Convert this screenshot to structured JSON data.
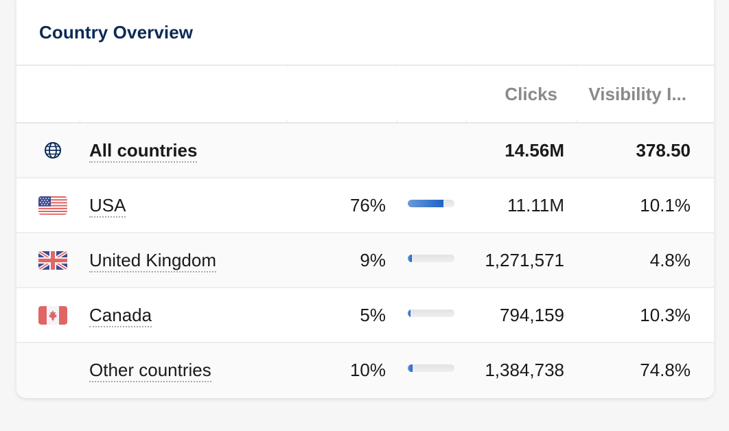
{
  "card": {
    "title": "Country Overview"
  },
  "table": {
    "columns": [
      {
        "key": "flag",
        "label": ""
      },
      {
        "key": "country",
        "label": ""
      },
      {
        "key": "share",
        "label": ""
      },
      {
        "key": "share_bar",
        "label": ""
      },
      {
        "key": "clicks",
        "label": "Clicks"
      },
      {
        "key": "visibility",
        "label": "Visibility I..."
      }
    ],
    "total": {
      "icon": "globe-icon",
      "country": "All countries",
      "clicks": "14.56M",
      "visibility": "378.50"
    },
    "rows": [
      {
        "icon": "flag-usa-icon",
        "country": "USA",
        "share": "76%",
        "share_fraction": 0.76,
        "clicks": "11.11M",
        "visibility": "10.1%"
      },
      {
        "icon": "flag-uk-icon",
        "country": "United Kingdom",
        "share": "9%",
        "share_fraction": 0.09,
        "clicks": "1,271,571",
        "visibility": "4.8%"
      },
      {
        "icon": "flag-canada-icon",
        "country": "Canada",
        "share": "5%",
        "share_fraction": 0.05,
        "clicks": "794,159",
        "visibility": "10.3%"
      },
      {
        "icon": "",
        "country": "Other countries",
        "share": "10%",
        "share_fraction": 0.1,
        "clicks": "1,384,738",
        "visibility": "74.8%"
      }
    ]
  },
  "colors": {
    "title": "#0b2a55",
    "header_text": "#8a8a8a",
    "bar_fill": "#1f62c9",
    "bar_track": "#e8e8e8"
  }
}
